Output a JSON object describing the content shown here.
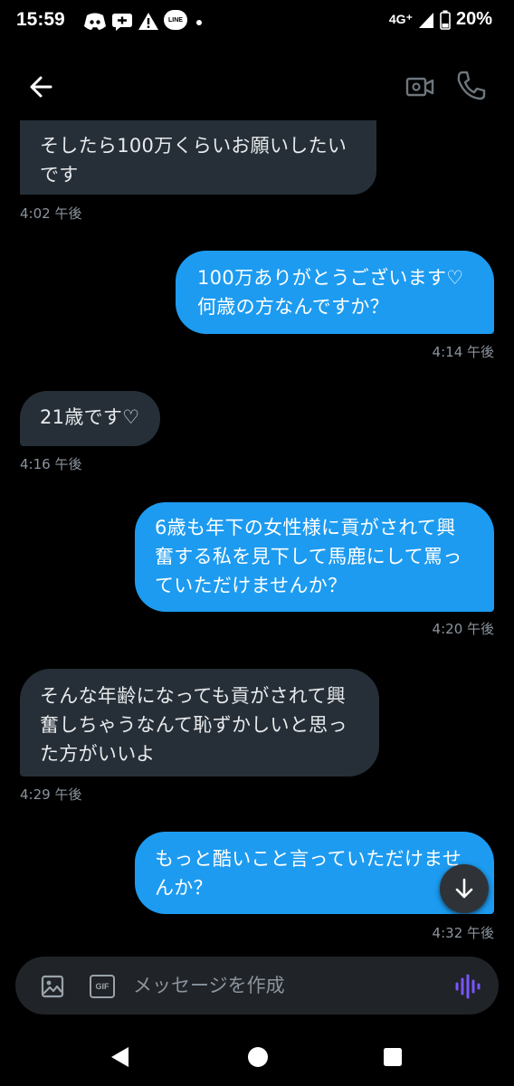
{
  "status_bar": {
    "time": "15:59",
    "network": "4G⁺",
    "battery": "20%",
    "icons": [
      "discord-icon",
      "chat-bubble-icon",
      "warning-icon",
      "line-icon",
      "dot-icon",
      "signal-icon",
      "battery-icon"
    ],
    "line_label": "LINE"
  },
  "header": {
    "icons": [
      "back-arrow-icon",
      "video-call-icon",
      "phone-icon"
    ]
  },
  "messages": [
    {
      "direction": "received",
      "text": "そしたら100万くらいお願いしたい\nです",
      "time": "4:02 午後"
    },
    {
      "direction": "sent",
      "text": "100万ありがとうございます♡\n何歳の方なんですか？",
      "time": "4:14 午後"
    },
    {
      "direction": "received",
      "text": "21歳です♡",
      "time": "4:16 午後"
    },
    {
      "direction": "sent",
      "text": "6歳も年下の女性様に貢がされて興\n奮する私を見下して馬鹿にして罵っ\nていただけませんか？",
      "time": "4:20 午後"
    },
    {
      "direction": "received",
      "text": "そんな年齢になっても貢がされて興\n奮しちゃうなんて恥ずかしいと思っ\nた方がいいよ",
      "time": "4:29 午後"
    },
    {
      "direction": "sent",
      "text": "もっと酷いこと言っていただけませ\nんか？",
      "time": "4:32 午後"
    }
  ],
  "composer": {
    "placeholder": "メッセージを作成",
    "gif_label": "GIF",
    "icons": [
      "image-icon",
      "gif-icon",
      "voice-icon"
    ]
  },
  "colors": {
    "background": "#000000",
    "received_bubble": "#262f37",
    "sent_bubble": "#1d9bf0",
    "timestamp": "#8b949e",
    "voice_accent": "#7856ff"
  }
}
